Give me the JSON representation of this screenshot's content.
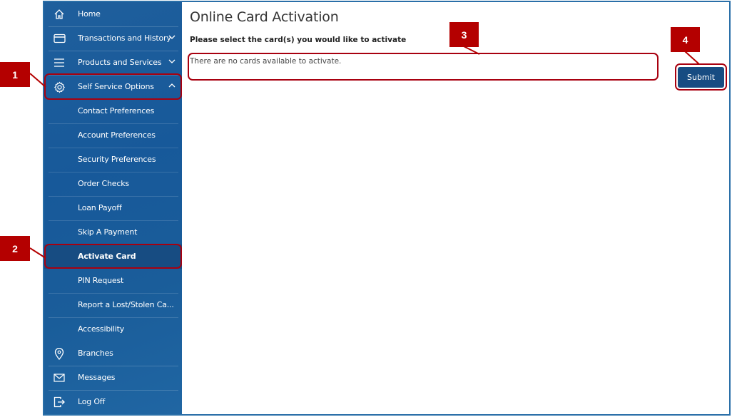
{
  "sidebar": {
    "items": [
      {
        "label": "Home",
        "icon": "home-icon"
      },
      {
        "label": "Transactions and History",
        "icon": "card-icon",
        "expandable": true
      },
      {
        "label": "Products and Services",
        "icon": "menu-icon",
        "expandable": true
      },
      {
        "label": "Self Service Options",
        "icon": "gear-icon",
        "expanded": true
      }
    ],
    "sub_items": [
      {
        "label": "Contact Preferences"
      },
      {
        "label": "Account Preferences"
      },
      {
        "label": "Security Preferences"
      },
      {
        "label": "Order Checks"
      },
      {
        "label": "Loan Payoff"
      },
      {
        "label": "Skip A Payment"
      },
      {
        "label": "Activate Card",
        "active": true
      },
      {
        "label": "PIN Request"
      },
      {
        "label": "Report a Lost/Stolen Ca..."
      },
      {
        "label": "Accessibility"
      }
    ],
    "bottom_items": [
      {
        "label": "Branches",
        "icon": "location-pin-icon"
      },
      {
        "label": "Messages",
        "icon": "envelope-icon"
      },
      {
        "label": "Log Off",
        "icon": "logout-icon"
      }
    ]
  },
  "main": {
    "title": "Online Card Activation",
    "instruction": "Please select the card(s) you would like to activate",
    "empty_message": "There are no cards available to activate.",
    "submit_label": "Submit"
  },
  "callouts": [
    "1",
    "2",
    "3",
    "4"
  ],
  "colors": {
    "sidebar_bg": "#1a5d9a",
    "active_item": "#174c82",
    "button": "#174c82",
    "callout": "#b40000"
  }
}
